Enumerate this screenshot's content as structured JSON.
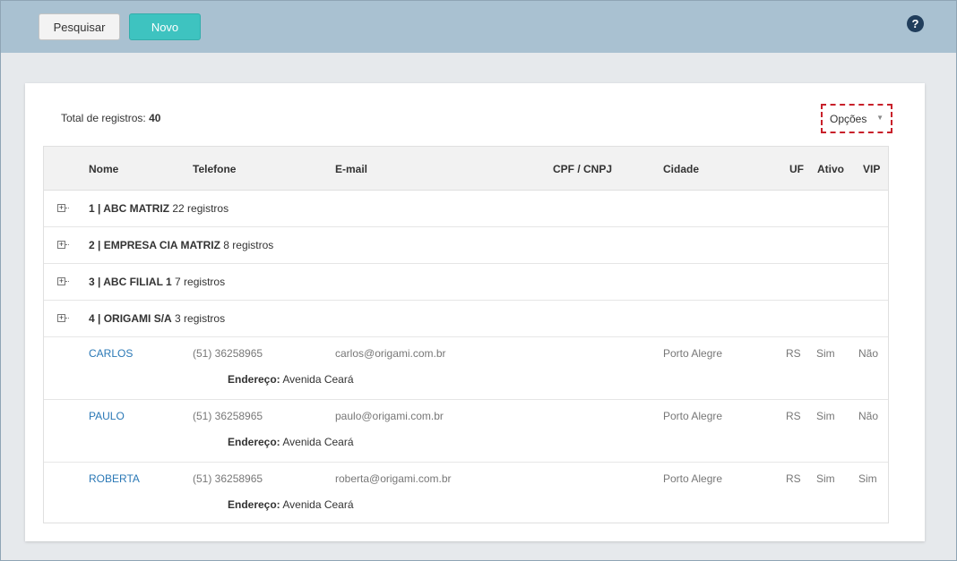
{
  "toolbar": {
    "search_label": "Pesquisar",
    "new_label": "Novo",
    "help_icon": "?"
  },
  "panel": {
    "total_label": "Total de registros:",
    "total_value": "40",
    "options_label": "Opções",
    "options_caret": "▼"
  },
  "table": {
    "headers": {
      "nome": "Nome",
      "telefone": "Telefone",
      "email": "E-mail",
      "cpf": "CPF / CNPJ",
      "cidade": "Cidade",
      "uf": "UF",
      "ativo": "Ativo",
      "vip": "VIP"
    },
    "groups": [
      {
        "title": "1 | ABC MATRIZ",
        "count": "22 registros",
        "expander": "+"
      },
      {
        "title": "2 | EMPRESA CIA MATRIZ",
        "count": "8 registros",
        "expander": "+"
      },
      {
        "title": "3 | ABC FILIAL 1",
        "count": "7 registros",
        "expander": "+"
      },
      {
        "title": "4 | ORIGAMI S/A",
        "count": "3 registros",
        "expander": "+"
      }
    ],
    "address_label": "Endereço:",
    "records": [
      {
        "nome": "CARLOS",
        "telefone": "(51) 36258965",
        "email": "carlos@origami.com.br",
        "cidade": "Porto Alegre",
        "uf": "RS",
        "ativo": "Sim",
        "vip": "Não",
        "endereco": "Avenida Ceará"
      },
      {
        "nome": "PAULO",
        "telefone": "(51) 36258965",
        "email": "paulo@origami.com.br",
        "cidade": "Porto Alegre",
        "uf": "RS",
        "ativo": "Sim",
        "vip": "Não",
        "endereco": "Avenida Ceará"
      },
      {
        "nome": "ROBERTA",
        "telefone": "(51) 36258965",
        "email": "roberta@origami.com.br",
        "cidade": "Porto Alegre",
        "uf": "RS",
        "ativo": "Sim",
        "vip": "Sim",
        "endereco": "Avenida Ceará"
      }
    ]
  },
  "colors": {
    "topbar": "#a9c1d1",
    "new_button": "#3ec3c0",
    "link": "#2a78b6",
    "highlight_border": "#c8202a"
  }
}
